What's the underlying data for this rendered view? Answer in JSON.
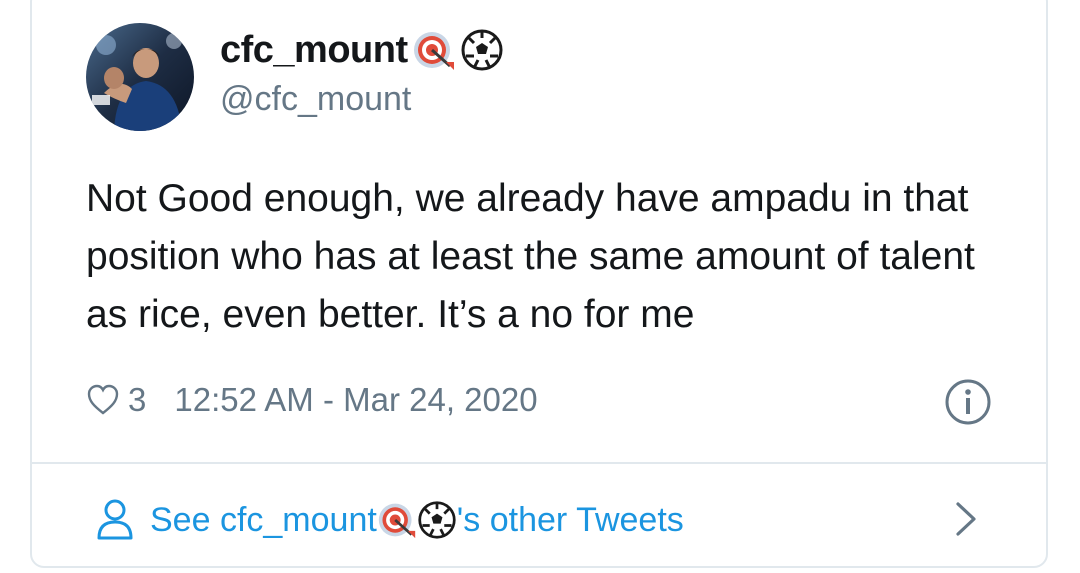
{
  "tweet": {
    "display_name": "cfc_mount",
    "handle": "@cfc_mount",
    "name_emojis": [
      "dart-target-emoji",
      "soccer-ball-emoji"
    ],
    "text": "Not Good enough, we already have ampadu in that position who has at least the same amount of talent as rice, even better. It’s a no for me",
    "like_count": "3",
    "timestamp": "12:52 AM - Mar 24, 2020"
  },
  "footer": {
    "see_prefix": "See cfc_mount",
    "see_suffix": "'s other Tweets"
  },
  "colors": {
    "link": "#1b95e0",
    "secondary": "#657786",
    "border": "#e1e8ed"
  }
}
